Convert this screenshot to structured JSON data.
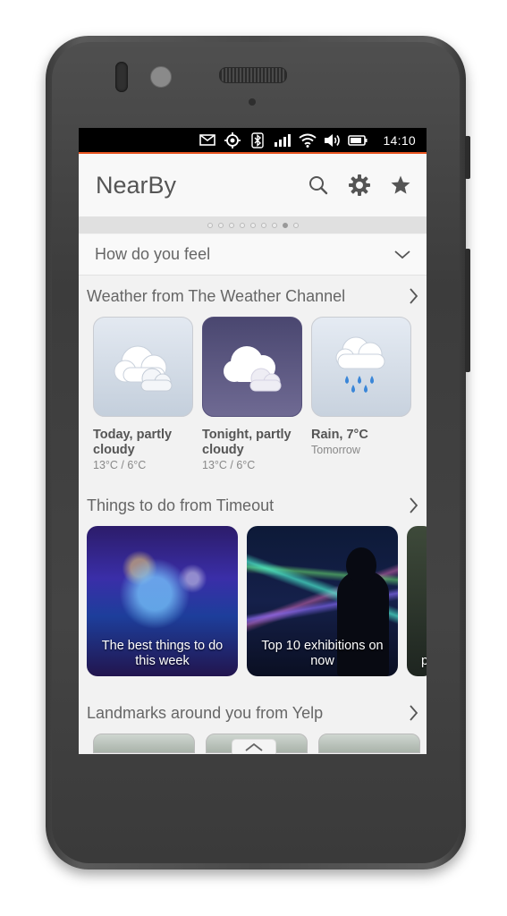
{
  "status_bar": {
    "time": "14:10",
    "icons": [
      "mail-icon",
      "location-icon",
      "bluetooth-icon",
      "signal-icon",
      "wifi-icon",
      "volume-icon",
      "battery-icon"
    ]
  },
  "header": {
    "title": "NearBy",
    "actions": [
      "search-icon",
      "gear-icon",
      "star-icon"
    ]
  },
  "pager": {
    "count": 9,
    "active_index": 7
  },
  "feel": {
    "label": "How do you feel"
  },
  "weather": {
    "heading": "Weather from The Weather Channel",
    "cards": [
      {
        "title": "Today, partly cloudy",
        "subtitle": "13°C / 6°C",
        "icon": "cloud-icon"
      },
      {
        "title": "Tonight, partly cloudy",
        "subtitle": "13°C / 6°C",
        "icon": "cloud-night-icon"
      },
      {
        "title": "Rain, 7°C",
        "subtitle": "Tomorrow",
        "icon": "rain-cloud-icon"
      }
    ]
  },
  "things": {
    "heading": "Things to do from Timeout",
    "cards": [
      {
        "caption": "The best things to do this week"
      },
      {
        "caption": "Top 10 exhibitions on now"
      },
      {
        "caption": "p"
      }
    ]
  },
  "landmarks": {
    "heading": "Landmarks around you from Yelp"
  },
  "colors": {
    "accent": "#e95420",
    "header_bg": "#f8f8f8",
    "screen_bg": "#f2f2f2"
  }
}
